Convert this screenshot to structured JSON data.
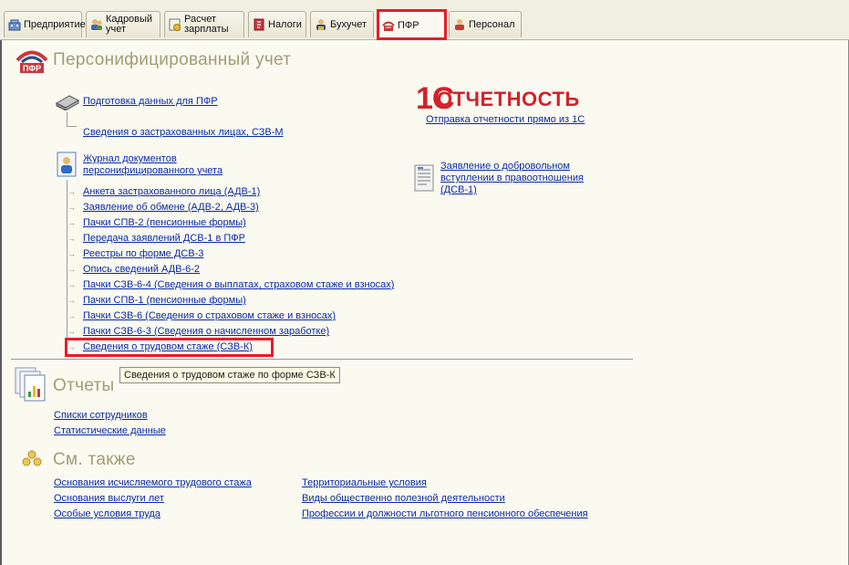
{
  "tabs": [
    {
      "label": "Предприятие",
      "icon": "enterprise-icon"
    },
    {
      "label": "Кадровый\nучет",
      "icon": "personnel-icon"
    },
    {
      "label": "Расчет\nзарплаты",
      "icon": "payroll-icon"
    },
    {
      "label": "Налоги",
      "icon": "taxes-icon"
    },
    {
      "label": "Бухучет",
      "icon": "accounting-icon"
    },
    {
      "label": "ПФР",
      "icon": "pfr-icon",
      "active": true
    },
    {
      "label": "Персонал",
      "icon": "staff-icon"
    }
  ],
  "colors": {
    "highlight": "#e41e26",
    "link": "#0a2aa8",
    "heading": "#a09e74",
    "background": "#fbfaf1"
  },
  "personal": {
    "title": "Персонифицированный учет",
    "prepare_link": "Подготовка данных для ПФР",
    "szvm_link": "Сведения о застрахованных лицах, СЗВ-М",
    "journal_link_1": "Журнал документов",
    "journal_link_2": "персонифицированного учета",
    "journal_items": [
      "Анкета застрахованного лица (АДВ-1)",
      "Заявление об обмене (АДВ-2, АДВ-3)",
      "Пачки СПВ-2 (пенсионные формы)",
      "Передача заявлений ДСВ-1 в ПФР",
      "Реестры по форме ДСВ-3",
      "Опись сведений АДВ-6-2",
      "Пачки СЗВ-6-4 (Сведения о выплатах, страховом стаже и взносах)",
      "Пачки СПВ-1 (пенсионные формы)",
      "Пачки СЗВ-6 (Сведения о страховом стаже и взносах)",
      "Пачки СЗВ-6-3 (Сведения о начисленном заработке)",
      "Сведения о трудовом стаже (СЗВ-К)"
    ],
    "tooltip": "Сведения о трудовом стаже по форме СЗВ-К",
    "brand_prefix": "1С",
    "brand_word": "ОТЧЕТНОСТЬ",
    "brand_link": "Отправка отчетности прямо из 1С",
    "dsv1_link_1": "Заявление о добровольном",
    "dsv1_link_2": "вступлении в правоотношения",
    "dsv1_link_3": "(ДСВ-1)"
  },
  "reports": {
    "title": "Отчеты",
    "items": [
      "Списки сотрудников",
      "Статистические данные"
    ]
  },
  "see_also": {
    "title": "См. также",
    "left": [
      "Основания исчисляемого трудового стажа",
      "Основания выслуги лет",
      "Особые условия труда"
    ],
    "right": [
      "Территориальные условия",
      "Виды общественно полезной деятельности",
      "Профессии и должности льготного пенсионного обеспечения"
    ]
  }
}
